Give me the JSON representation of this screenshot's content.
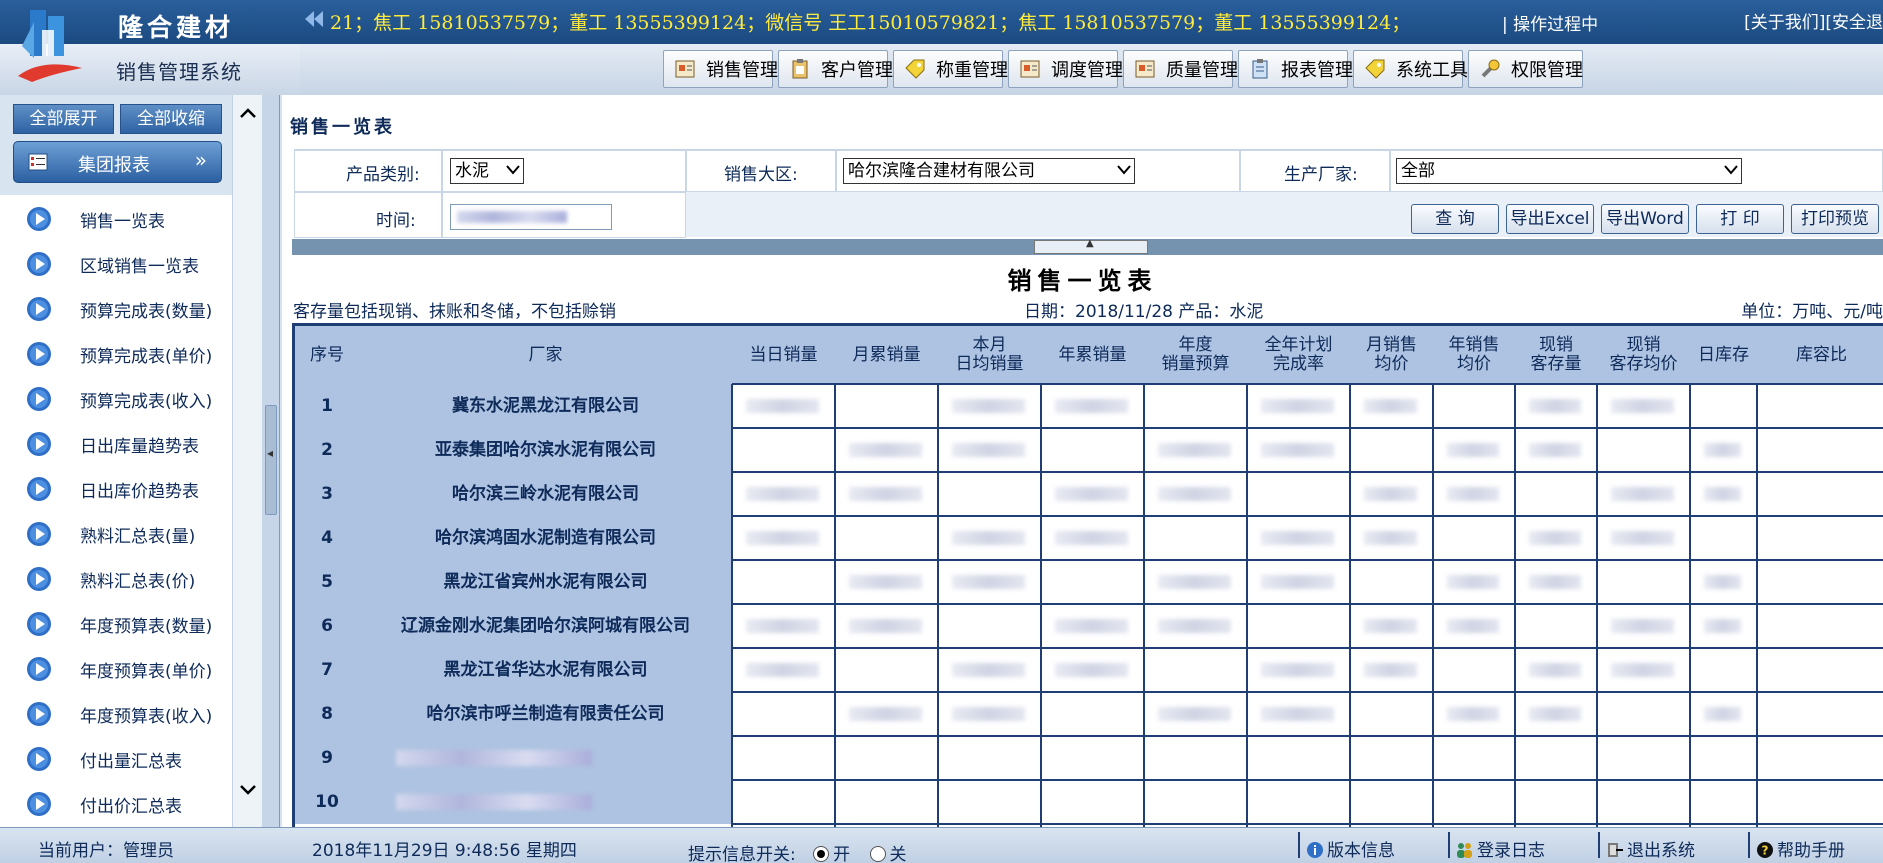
{
  "header": {
    "brand_name": "隆合建材",
    "system_name": "销售管理系统",
    "ticker": "21；焦工 15810537579；董工 13555399124；微信号 王工15010579821；焦工 15810537579；董工 13555399124；",
    "ticker_extra": "| 操作过程中",
    "links": [
      "[关于我们]",
      "[安全退"
    ]
  },
  "menu": [
    {
      "label": "销售管理",
      "icon": "document-icon"
    },
    {
      "label": "客户管理",
      "icon": "clipboard-icon"
    },
    {
      "label": "称重管理",
      "icon": "tag-icon"
    },
    {
      "label": "调度管理",
      "icon": "document-icon"
    },
    {
      "label": "质量管理",
      "icon": "document-icon"
    },
    {
      "label": "报表管理",
      "icon": "clipboard-icon"
    },
    {
      "label": "系统工具",
      "icon": "tag-icon"
    },
    {
      "label": "权限管理",
      "icon": "tool-icon"
    }
  ],
  "sidebar": {
    "expand_all": "全部展开",
    "collapse_all": "全部收缩",
    "group": "集团报表",
    "items": [
      {
        "label": "销售一览表"
      },
      {
        "label": "区域销售一览表"
      },
      {
        "label": "预算完成表(数量)"
      },
      {
        "label": "预算完成表(单价)"
      },
      {
        "label": "预算完成表(收入)"
      },
      {
        "label": "日出库量趋势表"
      },
      {
        "label": "日出库价趋势表"
      },
      {
        "label": "熟料汇总表(量)"
      },
      {
        "label": "熟料汇总表(价)"
      },
      {
        "label": "年度预算表(数量)"
      },
      {
        "label": "年度预算表(单价)"
      },
      {
        "label": "年度预算表(收入)"
      },
      {
        "label": "付出量汇总表"
      },
      {
        "label": "付出价汇总表"
      }
    ]
  },
  "main": {
    "title": "销售一览表",
    "filters": {
      "product_label": "产品类别:",
      "product_value": "水泥",
      "region_label": "销售大区:",
      "region_value": "哈尔滨隆合建材有限公司",
      "maker_label": "生产厂家:",
      "maker_value": "全部",
      "time_label": "时间:"
    },
    "buttons": {
      "query": "查 询",
      "export_excel": "导出Excel",
      "export_word": "导出Word",
      "print": "打 印",
      "print_preview": "打印预览"
    },
    "report": {
      "title": "销售一览表",
      "note": "客存量包括现销、抹账和冬储，不包括赊销",
      "date_line": "日期：2018/11/28 产品：水泥",
      "unit": "单位：万吨、元/吨",
      "columns": [
        "序号",
        "厂家",
        "当日销量",
        "月累销量",
        "本月\n日均销量",
        "年累销量",
        "年度\n销量预算",
        "全年计划\n完成率",
        "月销售\n均价",
        "年销售\n均价",
        "现销\n客存量",
        "现销\n客存均价",
        "日库存",
        "库容比"
      ],
      "rows": [
        {
          "seq": "1",
          "factory": "冀东水泥黑龙江有限公司"
        },
        {
          "seq": "2",
          "factory": "亚泰集团哈尔滨水泥有限公司"
        },
        {
          "seq": "3",
          "factory": "哈尔滨三岭水泥有限公司"
        },
        {
          "seq": "4",
          "factory": "哈尔滨鸿固水泥制造有限公司"
        },
        {
          "seq": "5",
          "factory": "黑龙江省宾州水泥有限公司"
        },
        {
          "seq": "6",
          "factory": "辽源金刚水泥集团哈尔滨阿城有限公司"
        },
        {
          "seq": "7",
          "factory": "黑龙江省华达水泥有限公司"
        },
        {
          "seq": "8",
          "factory": "哈尔滨市呼兰制造有限责任公司"
        },
        {
          "seq": "9",
          "factory": ""
        },
        {
          "seq": "10",
          "factory": ""
        }
      ]
    }
  },
  "footer": {
    "current_user": "当前用户：管理员",
    "datetime": "2018年11月29日 9:48:56 星期四",
    "hint_label": "提示信息开关:",
    "on_label": "开",
    "off_label": "关",
    "version": "版本信息",
    "login_log": "登录日志",
    "logout": "退出系统",
    "help": "帮助手册"
  },
  "colors": {
    "header_bg": "#1f4f86",
    "ticker_text": "#ffeb3b",
    "table_head": "#aec3e1",
    "grid": "#1f3f74",
    "label_text": "#0d2a59"
  }
}
